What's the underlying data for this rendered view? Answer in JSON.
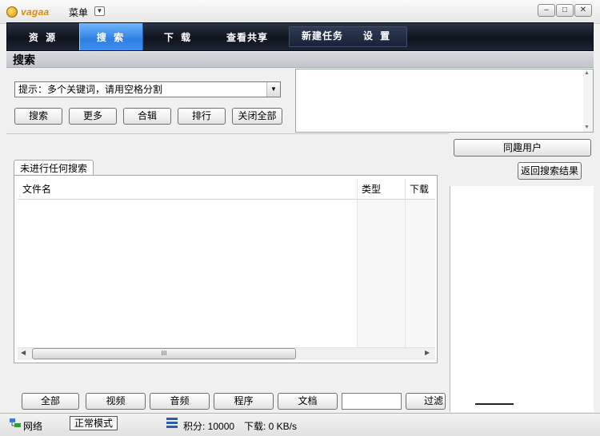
{
  "app": {
    "logo_text": "vagaa",
    "menu_label": "菜单",
    "window_buttons": [
      "–",
      "□",
      "✕"
    ]
  },
  "nav": {
    "tabs": [
      {
        "label": "资 源",
        "active": false
      },
      {
        "label": "搜 索",
        "active": true
      },
      {
        "label": "下 载",
        "active": false
      },
      {
        "label": "查看共享",
        "active": false
      },
      {
        "label": "新建任务",
        "active": false
      },
      {
        "label": "设 置",
        "active": false
      }
    ]
  },
  "search": {
    "header": "搜索",
    "hint": "提示：多个关键词，请用空格分割",
    "buttons": [
      "搜索",
      "更多",
      "合辑",
      "排行",
      "关闭全部"
    ]
  },
  "results": {
    "tab_label": "未进行任何搜索",
    "columns": [
      "文件名",
      "类型",
      "下载"
    ],
    "scroll_grip": "III"
  },
  "right_panel": {
    "similar_users": "同趣用户",
    "back_to_results": "返回搜索结果"
  },
  "filters": {
    "buttons": [
      "全部",
      "视频",
      "音频",
      "程序",
      "文档"
    ],
    "filter_button": "过滤"
  },
  "status": {
    "network": "网络",
    "mode": "正常模式",
    "score": "积分: 10000",
    "download": "下载: 0 KB/s"
  },
  "colors": {
    "nav_active": "#3d8ef0",
    "nav_bg": "#141a25",
    "logo": "#e08a00"
  }
}
